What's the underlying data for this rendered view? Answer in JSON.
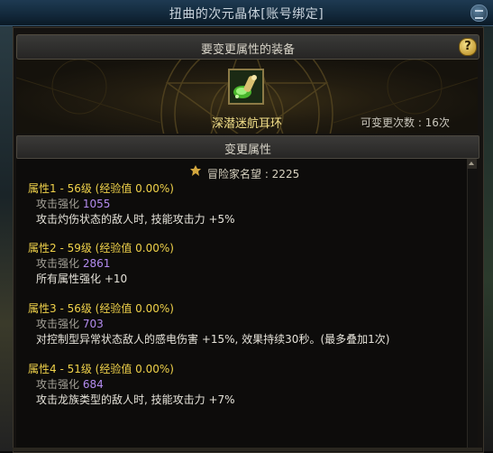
{
  "window": {
    "title": "扭曲的次元晶体[账号绑定]"
  },
  "equip_section": {
    "label": "要变更属性的装备"
  },
  "item": {
    "name": "深潜迷航耳环",
    "change_count": "可变更次数 : 16次"
  },
  "attr_section": {
    "label": "变更属性"
  },
  "fame": "冒险家名望 : 2225",
  "attributes": [
    {
      "head": "属性1 - 56级 (经验值 0.00%)",
      "enh_label": "攻击强化",
      "enh_value": "1055",
      "desc": "攻击灼伤状态的敌人时, 技能攻击力 +5%"
    },
    {
      "head": "属性2 - 59级 (经验值 0.00%)",
      "enh_label": "攻击强化",
      "enh_value": "2861",
      "desc": "所有属性强化 +10"
    },
    {
      "head": "属性3 - 56级 (经验值 0.00%)",
      "enh_label": "攻击强化",
      "enh_value": "703",
      "desc": "对控制型异常状态敌人的感电伤害 +15%, 效果持续30秒。(最多叠加1次)"
    },
    {
      "head": "属性4 - 51级 (经验值 0.00%)",
      "enh_label": "攻击强化",
      "enh_value": "684",
      "desc": "攻击龙族类型的敌人时, 技能攻击力 +7%"
    }
  ],
  "icons": {
    "help": "?"
  }
}
